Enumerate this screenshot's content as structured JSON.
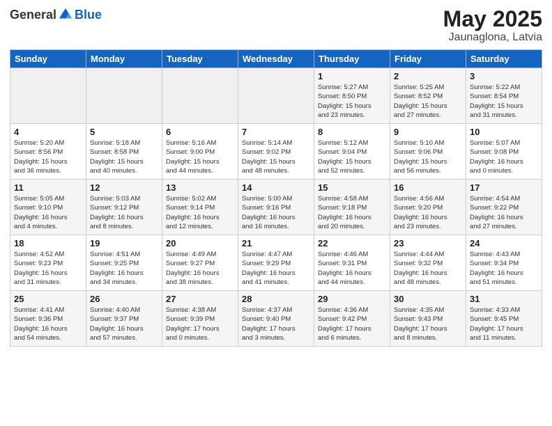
{
  "logo": {
    "general": "General",
    "blue": "Blue"
  },
  "title": "May 2025",
  "subtitle": "Jaunaglona, Latvia",
  "headers": [
    "Sunday",
    "Monday",
    "Tuesday",
    "Wednesday",
    "Thursday",
    "Friday",
    "Saturday"
  ],
  "weeks": [
    [
      {
        "day": "",
        "info": ""
      },
      {
        "day": "",
        "info": ""
      },
      {
        "day": "",
        "info": ""
      },
      {
        "day": "",
        "info": ""
      },
      {
        "day": "1",
        "info": "Sunrise: 5:27 AM\nSunset: 8:50 PM\nDaylight: 15 hours\nand 23 minutes."
      },
      {
        "day": "2",
        "info": "Sunrise: 5:25 AM\nSunset: 8:52 PM\nDaylight: 15 hours\nand 27 minutes."
      },
      {
        "day": "3",
        "info": "Sunrise: 5:22 AM\nSunset: 8:54 PM\nDaylight: 15 hours\nand 31 minutes."
      }
    ],
    [
      {
        "day": "4",
        "info": "Sunrise: 5:20 AM\nSunset: 8:56 PM\nDaylight: 15 hours\nand 36 minutes."
      },
      {
        "day": "5",
        "info": "Sunrise: 5:18 AM\nSunset: 8:58 PM\nDaylight: 15 hours\nand 40 minutes."
      },
      {
        "day": "6",
        "info": "Sunrise: 5:16 AM\nSunset: 9:00 PM\nDaylight: 15 hours\nand 44 minutes."
      },
      {
        "day": "7",
        "info": "Sunrise: 5:14 AM\nSunset: 9:02 PM\nDaylight: 15 hours\nand 48 minutes."
      },
      {
        "day": "8",
        "info": "Sunrise: 5:12 AM\nSunset: 9:04 PM\nDaylight: 15 hours\nand 52 minutes."
      },
      {
        "day": "9",
        "info": "Sunrise: 5:10 AM\nSunset: 9:06 PM\nDaylight: 15 hours\nand 56 minutes."
      },
      {
        "day": "10",
        "info": "Sunrise: 5:07 AM\nSunset: 9:08 PM\nDaylight: 16 hours\nand 0 minutes."
      }
    ],
    [
      {
        "day": "11",
        "info": "Sunrise: 5:05 AM\nSunset: 9:10 PM\nDaylight: 16 hours\nand 4 minutes."
      },
      {
        "day": "12",
        "info": "Sunrise: 5:03 AM\nSunset: 9:12 PM\nDaylight: 16 hours\nand 8 minutes."
      },
      {
        "day": "13",
        "info": "Sunrise: 5:02 AM\nSunset: 9:14 PM\nDaylight: 16 hours\nand 12 minutes."
      },
      {
        "day": "14",
        "info": "Sunrise: 5:00 AM\nSunset: 9:16 PM\nDaylight: 16 hours\nand 16 minutes."
      },
      {
        "day": "15",
        "info": "Sunrise: 4:58 AM\nSunset: 9:18 PM\nDaylight: 16 hours\nand 20 minutes."
      },
      {
        "day": "16",
        "info": "Sunrise: 4:56 AM\nSunset: 9:20 PM\nDaylight: 16 hours\nand 23 minutes."
      },
      {
        "day": "17",
        "info": "Sunrise: 4:54 AM\nSunset: 9:22 PM\nDaylight: 16 hours\nand 27 minutes."
      }
    ],
    [
      {
        "day": "18",
        "info": "Sunrise: 4:52 AM\nSunset: 9:23 PM\nDaylight: 16 hours\nand 31 minutes."
      },
      {
        "day": "19",
        "info": "Sunrise: 4:51 AM\nSunset: 9:25 PM\nDaylight: 16 hours\nand 34 minutes."
      },
      {
        "day": "20",
        "info": "Sunrise: 4:49 AM\nSunset: 9:27 PM\nDaylight: 16 hours\nand 38 minutes."
      },
      {
        "day": "21",
        "info": "Sunrise: 4:47 AM\nSunset: 9:29 PM\nDaylight: 16 hours\nand 41 minutes."
      },
      {
        "day": "22",
        "info": "Sunrise: 4:46 AM\nSunset: 9:31 PM\nDaylight: 16 hours\nand 44 minutes."
      },
      {
        "day": "23",
        "info": "Sunrise: 4:44 AM\nSunset: 9:32 PM\nDaylight: 16 hours\nand 48 minutes."
      },
      {
        "day": "24",
        "info": "Sunrise: 4:43 AM\nSunset: 9:34 PM\nDaylight: 16 hours\nand 51 minutes."
      }
    ],
    [
      {
        "day": "25",
        "info": "Sunrise: 4:41 AM\nSunset: 9:36 PM\nDaylight: 16 hours\nand 54 minutes."
      },
      {
        "day": "26",
        "info": "Sunrise: 4:40 AM\nSunset: 9:37 PM\nDaylight: 16 hours\nand 57 minutes."
      },
      {
        "day": "27",
        "info": "Sunrise: 4:38 AM\nSunset: 9:39 PM\nDaylight: 17 hours\nand 0 minutes."
      },
      {
        "day": "28",
        "info": "Sunrise: 4:37 AM\nSunset: 9:40 PM\nDaylight: 17 hours\nand 3 minutes."
      },
      {
        "day": "29",
        "info": "Sunrise: 4:36 AM\nSunset: 9:42 PM\nDaylight: 17 hours\nand 6 minutes."
      },
      {
        "day": "30",
        "info": "Sunrise: 4:35 AM\nSunset: 9:43 PM\nDaylight: 17 hours\nand 8 minutes."
      },
      {
        "day": "31",
        "info": "Sunrise: 4:33 AM\nSunset: 9:45 PM\nDaylight: 17 hours\nand 11 minutes."
      }
    ]
  ]
}
